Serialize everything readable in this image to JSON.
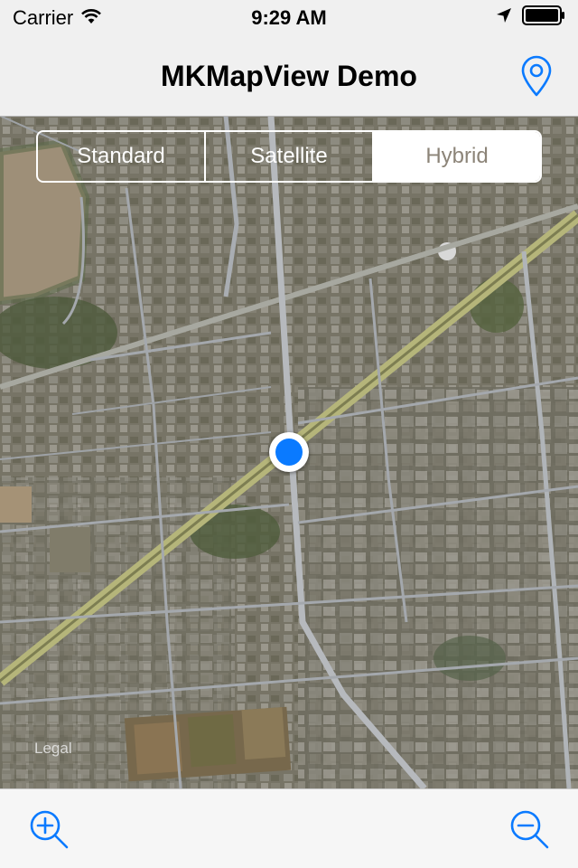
{
  "status_bar": {
    "carrier": "Carrier",
    "time": "9:29 AM",
    "icons": [
      "wifi-icon",
      "location-arrow-icon",
      "battery-icon"
    ]
  },
  "nav_bar": {
    "title": "MKMapView Demo",
    "right_button_icon": "location-pin-icon"
  },
  "map": {
    "map_types": [
      "Standard",
      "Satellite",
      "Hybrid"
    ],
    "selected_map_type": "Hybrid",
    "legal_label": "Legal",
    "user_location_color": "#0a7aff"
  },
  "toolbar": {
    "left_icon": "zoom-in-icon",
    "right_icon": "zoom-out-icon"
  },
  "colors": {
    "accent": "#0a7aff",
    "bar_background": "#f0f0f0",
    "selected_segment_text": "#8c8478"
  }
}
